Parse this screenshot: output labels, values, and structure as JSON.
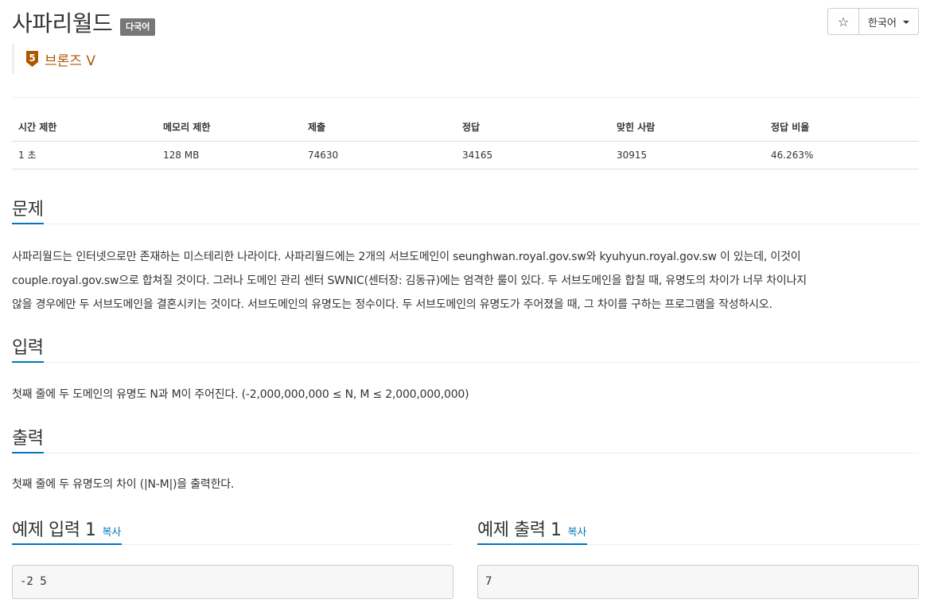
{
  "header": {
    "title": "사파리월드",
    "lang_badge": "다국어",
    "star_icon": "☆",
    "language_label": "한국어"
  },
  "tier": {
    "level": "5",
    "label": "브론즈 V",
    "color": "#ad5600"
  },
  "info_table": {
    "headers": [
      "시간 제한",
      "메모리 제한",
      "제출",
      "정답",
      "맞힌 사람",
      "정답 비율"
    ],
    "values": [
      "1 초",
      "128 MB",
      "74630",
      "34165",
      "30915",
      "46.263%"
    ]
  },
  "problem": {
    "title": "문제",
    "lines": [
      "사파리월드는 인터넷으로만 존재하는 미스테리한 나라이다. 사파리월드에는 2개의 서브도메인이 seunghwan.royal.gov.sw와 kyuhyun.royal.gov.sw 이 있는데, 이것이",
      "couple.royal.gov.sw으로 합쳐질 것이다. 그러나 도메인 관리 센터 SWNIC(센터장: 김동규)에는 엄격한 룰이 있다. 두 서브도메인을 합칠 때, 유명도의 차이가 너무 차이나지",
      "않을 경우에만 두 서브도메인을 결혼시키는 것이다. 서브도메인의 유명도는 정수이다. 두 서브도메인의 유명도가 주어졌을 때, 그 차이를 구하는 프로그램을 작성하시오."
    ]
  },
  "input": {
    "title": "입력",
    "text": "첫째 줄에 두 도메인의 유명도 N과 M이 주어진다. (-2,000,000,000 ≤ N, M ≤ 2,000,000,000)"
  },
  "output": {
    "title": "출력",
    "text": "첫째 줄에 두 유명도의 차이 (|N-M|)을 출력한다."
  },
  "samples": {
    "input_title": "예제 입력 1",
    "output_title": "예제 출력 1",
    "copy_label": "복사",
    "input_value": "-2 5",
    "output_value": "7"
  },
  "colors": {
    "accent": "#0076c0",
    "badge_bg": "#777777"
  }
}
